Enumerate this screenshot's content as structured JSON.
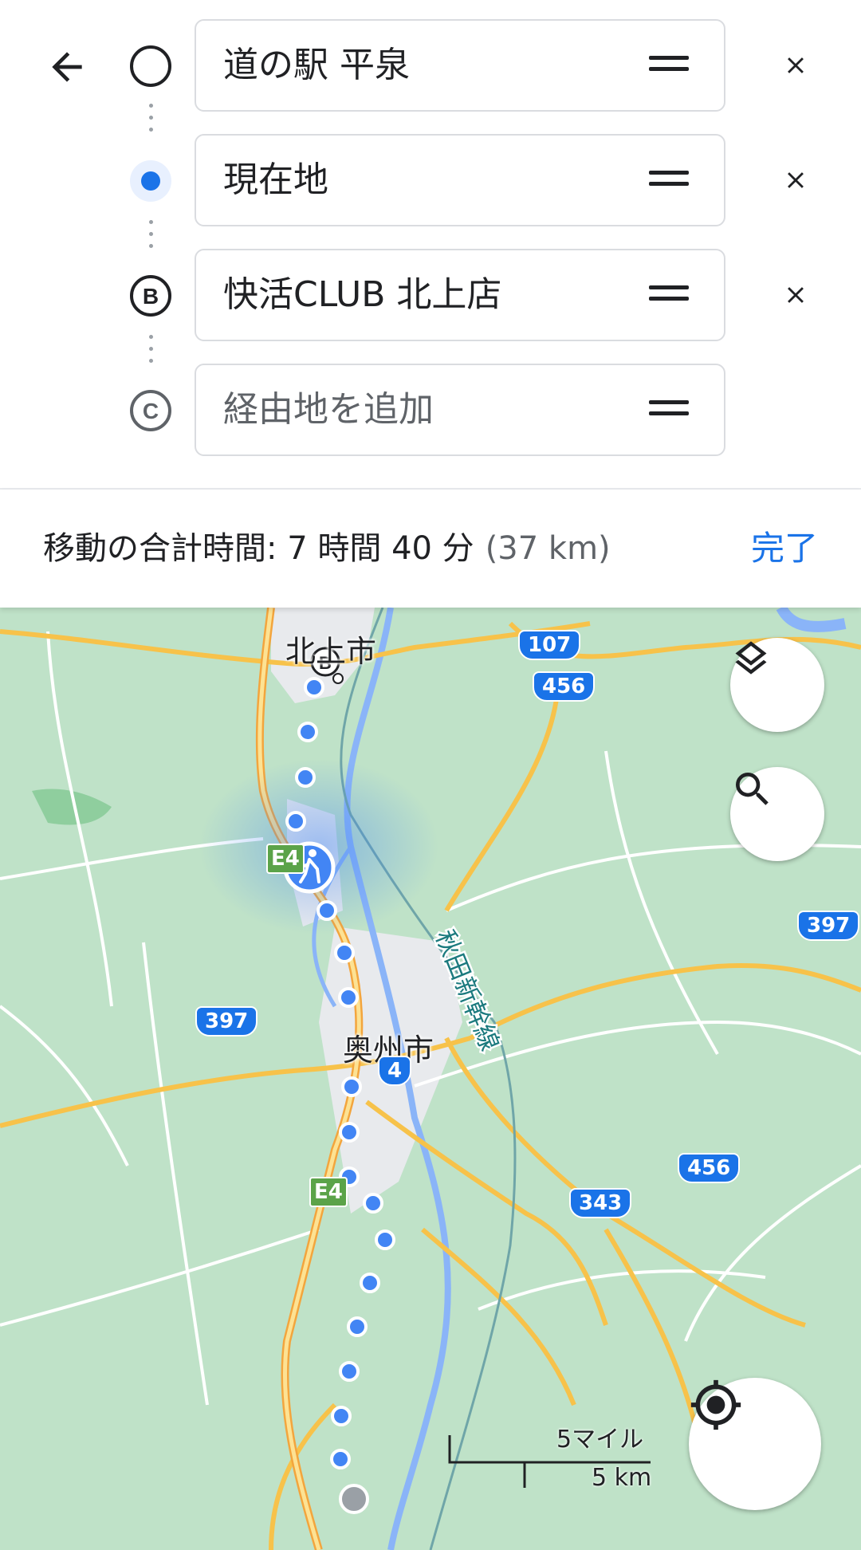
{
  "route": {
    "stops": [
      {
        "marker": "empty-circle",
        "label": "道の駅 平泉",
        "removable": true
      },
      {
        "marker": "current-location",
        "label": "現在地",
        "removable": true
      },
      {
        "marker": "B",
        "label": "快活CLUB 北上店",
        "removable": true
      },
      {
        "marker": "C",
        "label": "",
        "placeholder": "経由地を追加",
        "removable": false
      }
    ]
  },
  "summary": {
    "label": "移動の合計時間: 7 時間 40 分",
    "distance": "(37 km)",
    "done": "完了"
  },
  "map": {
    "city_labels": [
      "北上市",
      "奥州市"
    ],
    "rail_label": "秋田新幹線",
    "road_shields": [
      "107",
      "456",
      "397",
      "397",
      "4",
      "456",
      "343"
    ],
    "expressway_shields": [
      "E4",
      "E4"
    ],
    "scale": {
      "imperial": "5マイル",
      "metric": "5 km"
    },
    "destination_marker": "B",
    "colors": {
      "land": "#bfe2c8",
      "route": "#4285f4",
      "road": "#f7c24a",
      "urban": "#e8eaed",
      "water": "#8ab4f8"
    }
  }
}
